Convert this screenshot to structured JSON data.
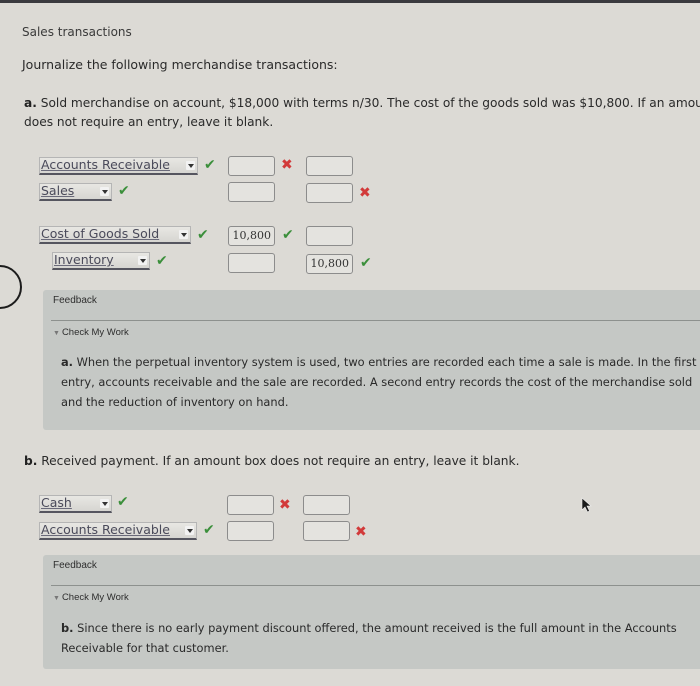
{
  "page": {
    "title": "Sales transactions",
    "instruction": "Journalize the following merchandise transactions:"
  },
  "part_a": {
    "label": "a.",
    "text": "Sold merchandise on account, $18,000 with terms n/30. The cost of the goods sold was $10,800. If an amount bo",
    "text_line2": "does not require an entry, leave it blank.",
    "rows": [
      {
        "account": "Accounts Receivable",
        "account_status": "correct",
        "debit": "",
        "debit_status": "incorrect",
        "credit": "",
        "credit_status": ""
      },
      {
        "account": "Sales",
        "account_status": "correct",
        "debit": "",
        "debit_status": "",
        "credit": "",
        "credit_status": "incorrect"
      },
      {
        "account": "Cost of Goods Sold",
        "account_status": "correct",
        "debit": "10,800",
        "debit_status": "correct",
        "credit": "",
        "credit_status": ""
      },
      {
        "account": "Inventory",
        "account_status": "correct",
        "debit": "",
        "debit_status": "",
        "credit": "10,800",
        "credit_status": "correct"
      }
    ],
    "feedback": {
      "title": "Feedback",
      "toggle": "Check My Work",
      "label": "a.",
      "text": "When the perpetual inventory system is used, two entries are recorded each time a sale is made. In the first entry, accounts receivable and the sale are recorded. A second entry records the cost of the merchandise sold and the reduction of inventory on hand."
    }
  },
  "part_b": {
    "label": "b.",
    "text": "Received payment. If an amount box does not require an entry, leave it blank.",
    "rows": [
      {
        "account": "Cash",
        "account_status": "correct",
        "debit": "",
        "debit_status": "incorrect",
        "credit": "",
        "credit_status": ""
      },
      {
        "account": "Accounts Receivable",
        "account_status": "correct",
        "debit": "",
        "debit_status": "",
        "credit": "",
        "credit_status": "incorrect"
      }
    ],
    "feedback": {
      "title": "Feedback",
      "toggle": "Check My Work",
      "label": "b.",
      "text": "Since there is no early payment discount offered, the amount received is the full amount in the Accounts Receivable for that customer."
    }
  },
  "icons": {
    "check": "✔",
    "cross": "✖",
    "toggle": "▼"
  },
  "colors": {
    "correct": "#3b8f3b",
    "incorrect": "#d23a3a",
    "feedback_bg": "#c5c8c5"
  }
}
